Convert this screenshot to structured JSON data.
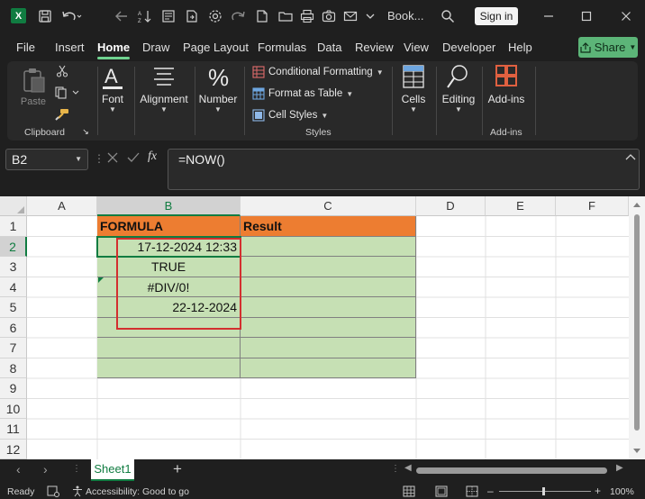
{
  "titlebar": {
    "title": "Book...",
    "signin": "Sign in",
    "logo": "X"
  },
  "menu": {
    "tabs": [
      "File",
      "Insert",
      "Home",
      "Draw",
      "Page Layout",
      "Formulas",
      "Data",
      "Review",
      "View",
      "Developer",
      "Help"
    ],
    "share": "Share"
  },
  "ribbon": {
    "paste": "Paste",
    "clipboard": "Clipboard",
    "font": "Font",
    "alignment": "Alignment",
    "number": "Number",
    "conditional_formatting": "Conditional Formatting",
    "format_as_table": "Format as Table",
    "cell_styles": "Cell Styles",
    "styles": "Styles",
    "cells": "Cells",
    "editing": "Editing",
    "addins": "Add-ins",
    "addins_group": "Add-ins"
  },
  "formula_bar": {
    "name_box": "B2",
    "fx": "fx",
    "formula": "=NOW()"
  },
  "grid": {
    "columns": [
      "A",
      "B",
      "C",
      "D",
      "E",
      "F"
    ],
    "rows": [
      "1",
      "2",
      "3",
      "4",
      "5",
      "6",
      "7",
      "8",
      "9",
      "10",
      "11",
      "12"
    ],
    "header_b": "FORMULA",
    "header_c": "Result",
    "b2": "17-12-2024 12:33",
    "b3": "TRUE",
    "b4": "#DIV/0!",
    "b5": "22-12-2024"
  },
  "sheets": {
    "active": "Sheet1",
    "add": "+"
  },
  "status": {
    "ready": "Ready",
    "accessibility": "Accessibility: Good to go",
    "zoom": "100%"
  },
  "colors": {
    "accent": "#107c41",
    "header_fill": "#ed7d31",
    "cell_fill": "#c6e0b4",
    "highlight_box": "#d32f2f"
  }
}
